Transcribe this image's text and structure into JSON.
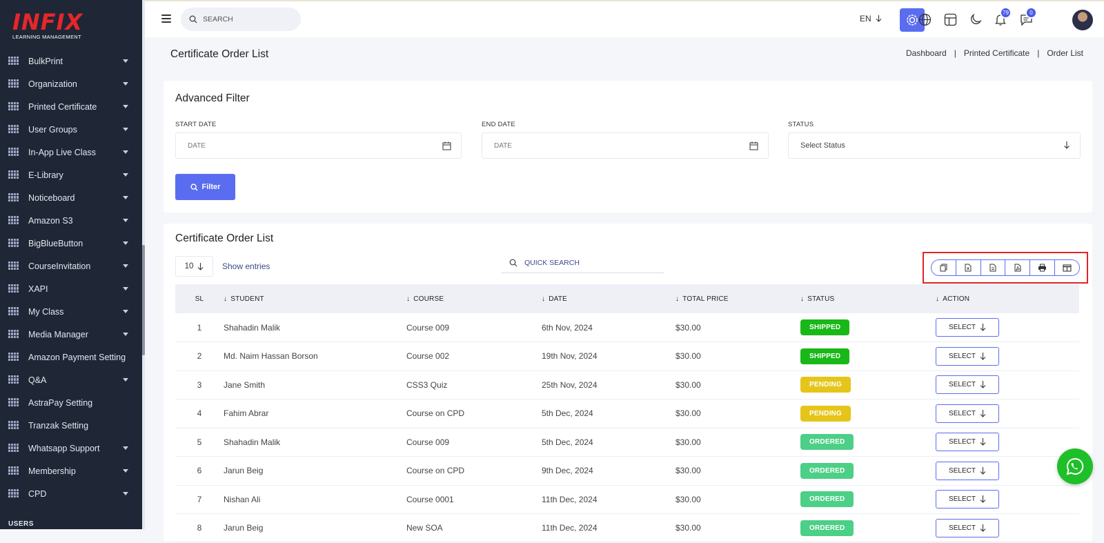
{
  "brand": {
    "name": "INFIX",
    "tagline": "LEARNING MANAGEMENT"
  },
  "sidebar": {
    "items": [
      {
        "label": "BulkPrint",
        "caret": true
      },
      {
        "label": "Organization",
        "caret": true
      },
      {
        "label": "Printed Certificate",
        "caret": true
      },
      {
        "label": "User Groups",
        "caret": true
      },
      {
        "label": "In-App Live Class",
        "caret": true
      },
      {
        "label": "E-Library",
        "caret": true
      },
      {
        "label": "Noticeboard",
        "caret": true
      },
      {
        "label": "Amazon S3",
        "caret": true
      },
      {
        "label": "BigBlueButton",
        "caret": true
      },
      {
        "label": "CourseInvitation",
        "caret": true
      },
      {
        "label": "XAPI",
        "caret": true
      },
      {
        "label": "My Class",
        "caret": true
      },
      {
        "label": "Media Manager",
        "caret": true
      },
      {
        "label": "Amazon Payment Setting",
        "caret": false
      },
      {
        "label": "Q&A",
        "caret": true
      },
      {
        "label": "AstraPay Setting",
        "caret": false
      },
      {
        "label": "Tranzak Setting",
        "caret": false
      },
      {
        "label": "Whatsapp Support",
        "caret": true
      },
      {
        "label": "Membership",
        "caret": true
      },
      {
        "label": "CPD",
        "caret": true
      }
    ],
    "section_heading": "USERS"
  },
  "topbar": {
    "search_placeholder": "SEARCH",
    "language": "EN",
    "notifications_count": "79",
    "messages_count": "0"
  },
  "page": {
    "title": "Certificate Order List",
    "breadcrumb": [
      "Dashboard",
      "Printed Certificate",
      "Order List"
    ]
  },
  "filter": {
    "title": "Advanced Filter",
    "start_date_label": "START DATE",
    "start_date_placeholder": "DATE",
    "end_date_label": "END DATE",
    "end_date_placeholder": "DATE",
    "status_label": "STATUS",
    "status_value": "Select Status",
    "button_label": "Filter"
  },
  "list": {
    "title": "Certificate Order List",
    "entries": "10",
    "show_entries_label": "Show entries",
    "quick_search_placeholder": "QUICK SEARCH",
    "export_buttons": [
      "copy-icon",
      "excel-icon",
      "csv-icon",
      "pdf-icon",
      "print-icon",
      "columns-icon"
    ],
    "columns": [
      "SL",
      "STUDENT",
      "COURSE",
      "DATE",
      "TOTAL PRICE",
      "STATUS",
      "ACTION"
    ],
    "rows": [
      {
        "sl": "1",
        "student": "Shahadin Malik",
        "course": "Course 009",
        "date": "6th Nov, 2024",
        "price": "$30.00",
        "status": "SHIPPED"
      },
      {
        "sl": "2",
        "student": "Md. Naim Hassan Borson",
        "course": "Course 002",
        "date": "19th Nov, 2024",
        "price": "$30.00",
        "status": "SHIPPED"
      },
      {
        "sl": "3",
        "student": "Jane Smith",
        "course": "CSS3 Quiz",
        "date": "25th Nov, 2024",
        "price": "$30.00",
        "status": "PENDING"
      },
      {
        "sl": "4",
        "student": "Fahim Abrar",
        "course": "Course on CPD",
        "date": "5th Dec, 2024",
        "price": "$30.00",
        "status": "PENDING"
      },
      {
        "sl": "5",
        "student": "Shahadin Malik",
        "course": "Course 009",
        "date": "5th Dec, 2024",
        "price": "$30.00",
        "status": "ORDERED"
      },
      {
        "sl": "6",
        "student": "Jarun Beig",
        "course": "Course on CPD",
        "date": "9th Dec, 2024",
        "price": "$30.00",
        "status": "ORDERED"
      },
      {
        "sl": "7",
        "student": "Nishan Ali",
        "course": "Course 0001",
        "date": "11th Dec, 2024",
        "price": "$30.00",
        "status": "ORDERED"
      },
      {
        "sl": "8",
        "student": "Jarun Beig",
        "course": "New SOA",
        "date": "11th Dec, 2024",
        "price": "$30.00",
        "status": "ORDERED"
      }
    ],
    "action_label": "SELECT"
  },
  "colors": {
    "accent": "#5a6cf0",
    "sidebar_bg": "#1f2636",
    "shipped": "#18b818",
    "pending": "#e5c51a",
    "ordered": "#4ccf86",
    "whatsapp": "#1fbf2a"
  }
}
